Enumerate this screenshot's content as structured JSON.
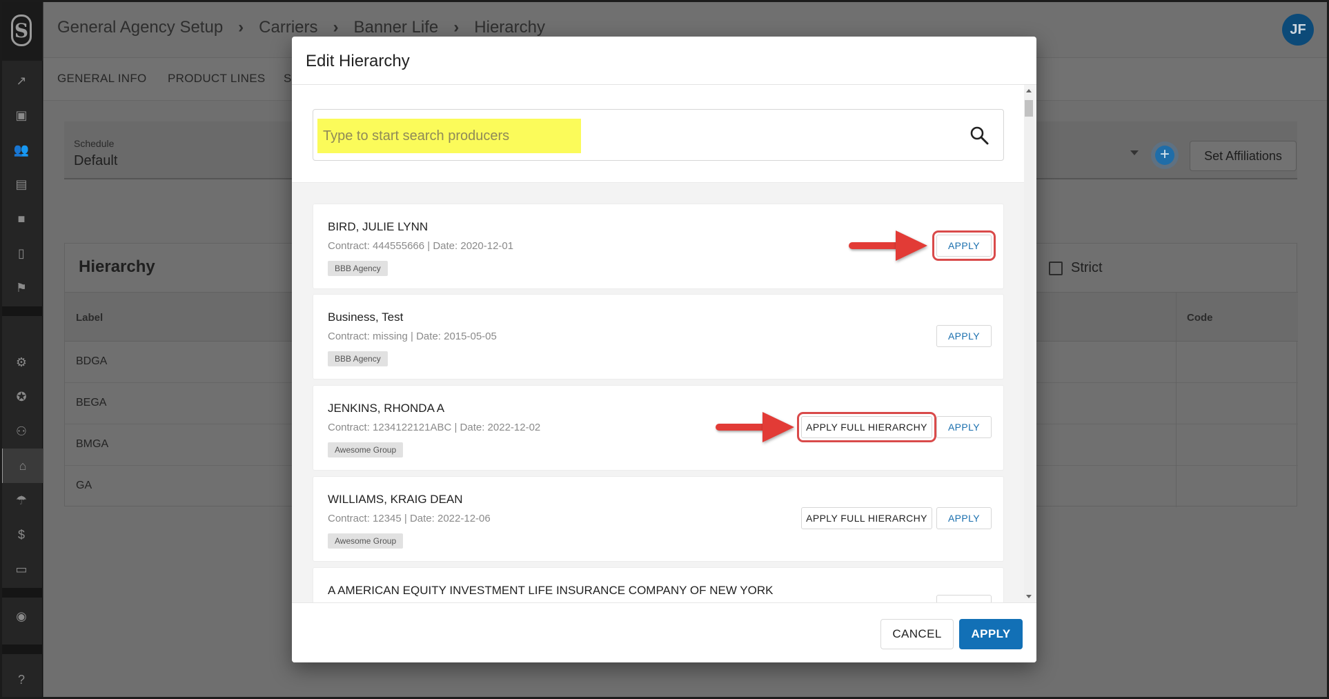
{
  "breadcrumbs": [
    "General Agency Setup",
    "Carriers",
    "Banner Life",
    "Hierarchy"
  ],
  "user_initials": "JF",
  "page_tabs": [
    "GENERAL INFO",
    "PRODUCT LINES",
    "S"
  ],
  "schedule": {
    "label": "Schedule",
    "value": "Default",
    "set_affiliations_label": "Set Affiliations",
    "add_icon": "plus-circle-icon"
  },
  "hierarchy": {
    "title": "Hierarchy",
    "strict_label": "Strict",
    "strict_checked": false,
    "columns": {
      "label": "Label",
      "code": "Code"
    },
    "rows": [
      "BDGA",
      "BEGA",
      "BMGA",
      "GA"
    ]
  },
  "sidebar": {
    "icons": [
      "chart-line-icon",
      "monitor-icon",
      "users-icon",
      "store-icon",
      "briefcase-icon",
      "document-icon",
      "flag-icon",
      "gear-icon",
      "star-badge-icon",
      "user-settings-icon",
      "bank-icon",
      "umbrella-icon",
      "dollar-icon",
      "card-icon",
      "coin-icon",
      "help-icon"
    ],
    "active": "bank-icon"
  },
  "modal": {
    "title": "Edit Hierarchy",
    "search_placeholder": "Type to start search producers",
    "producers": [
      {
        "name": "BIRD, JULIE LYNN",
        "meta": "Contract: 444555666   | Date: 2020-12-01",
        "tag": "BBB Agency",
        "full_hierarchy": false
      },
      {
        "name": "Business, Test",
        "meta": "Contract: missing   | Date: 2015-05-05",
        "tag": "BBB Agency",
        "full_hierarchy": false
      },
      {
        "name": "JENKINS, RHONDA A",
        "meta": "Contract: 1234122121ABC   | Date: 2022-12-02",
        "tag": "Awesome Group",
        "full_hierarchy": true
      },
      {
        "name": "WILLIAMS, KRAIG DEAN",
        "meta": "Contract: 12345   | Date: 2022-12-06",
        "tag": "Awesome Group",
        "full_hierarchy": true
      },
      {
        "name": "A AMERICAN EQUITY INVESTMENT LIFE INSURANCE COMPANY OF NEW YORK",
        "meta": "",
        "tag": "",
        "full_hierarchy": false
      }
    ],
    "apply_label": "APPLY",
    "apply_full_label": "APPLY FULL HIERARCHY",
    "cancel_label": "CANCEL",
    "confirm_label": "APPLY"
  },
  "colors": {
    "primary": "#1270b6",
    "annotation_red": "#e23b36",
    "highlight_yellow": "#fbfb5a"
  }
}
